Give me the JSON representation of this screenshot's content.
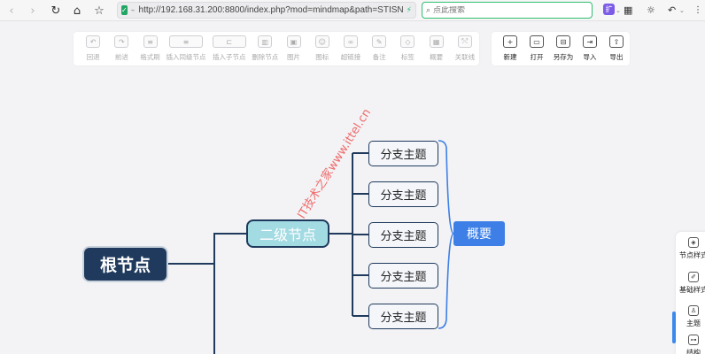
{
  "browser": {
    "url": "http://192.168.31.200:8800/index.php?mod=mindmap&path=STISN",
    "search_placeholder": "点此搜索",
    "ext_badge": "扩"
  },
  "toolbar": {
    "tools": [
      {
        "label": "回退",
        "icon": "undo-icon",
        "glyph": "↶"
      },
      {
        "label": "前进",
        "icon": "redo-icon",
        "glyph": "↷"
      },
      {
        "label": "格式刷",
        "icon": "format-brush-icon",
        "glyph": "≡"
      },
      {
        "label": "插入同级节点",
        "icon": "sibling-node-icon",
        "glyph": "≡"
      },
      {
        "label": "插入子节点",
        "icon": "child-node-icon",
        "glyph": "⊏"
      },
      {
        "label": "删除节点",
        "icon": "delete-node-icon",
        "glyph": "▥"
      },
      {
        "label": "图片",
        "icon": "image-icon",
        "glyph": "▣"
      },
      {
        "label": "图标",
        "icon": "emoji-icon",
        "glyph": "☺"
      },
      {
        "label": "超链接",
        "icon": "link-icon",
        "glyph": "∞"
      },
      {
        "label": "备注",
        "icon": "note-icon",
        "glyph": "✎"
      },
      {
        "label": "标签",
        "icon": "tag-icon",
        "glyph": "◇"
      },
      {
        "label": "概要",
        "icon": "summary-icon",
        "glyph": "▦"
      },
      {
        "label": "关联线",
        "icon": "association-line-icon",
        "glyph": "⤲"
      }
    ],
    "file_tools": [
      {
        "label": "新建",
        "icon": "new-file-icon",
        "glyph": "+"
      },
      {
        "label": "打开",
        "icon": "open-folder-icon",
        "glyph": "▭"
      },
      {
        "label": "另存为",
        "icon": "save-as-icon",
        "glyph": "⊟"
      },
      {
        "label": "导入",
        "icon": "import-icon",
        "glyph": "⇥"
      },
      {
        "label": "导出",
        "icon": "export-icon",
        "glyph": "⇧"
      }
    ]
  },
  "mindmap": {
    "root": "根节点",
    "second": "二级节点",
    "branches": [
      "分支主题",
      "分支主题",
      "分支主题",
      "分支主题",
      "分支主题"
    ],
    "summary": "概要",
    "watermark": "IT技术之家www.ittel.cn"
  },
  "side_panel": {
    "items": [
      {
        "label": "节点样式",
        "icon": "node-style-icon",
        "glyph": "◈"
      },
      {
        "label": "基础样式",
        "icon": "base-style-icon",
        "glyph": "✐"
      },
      {
        "label": "主题",
        "icon": "theme-icon",
        "glyph": "♙"
      },
      {
        "label": "结构",
        "icon": "structure-icon",
        "glyph": "⊶"
      }
    ]
  },
  "colors": {
    "root": "#1f3a5d",
    "second": "#a3dbe3",
    "summary": "#3d7fe6",
    "bracket": "#3d7fe6",
    "search_border": "#2fbf71"
  }
}
